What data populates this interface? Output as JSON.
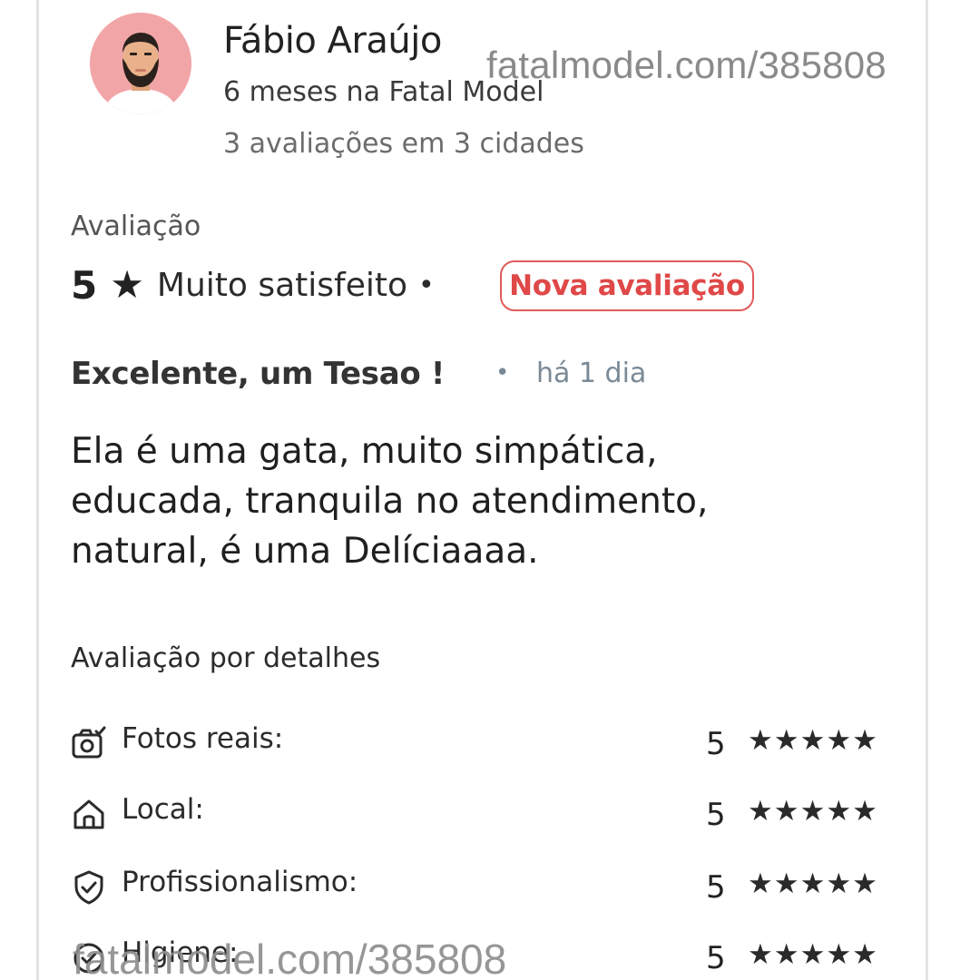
{
  "user": {
    "name": "Fábio Araújo",
    "tenure": "6 meses na Fatal Model",
    "stats": "3 avaliações em 3 cidades"
  },
  "watermark": {
    "top": "fatalmodel.com/385808",
    "bottom": "fatalmodel.com/385808"
  },
  "rating": {
    "section_label": "Avaliação",
    "score": "5",
    "star_glyph": "★",
    "description": "Muito satisfeito",
    "separator": "•",
    "badge": "Nova avaliação"
  },
  "review": {
    "title": "Excelente, um Tesao !",
    "separator": "•",
    "time": "há 1 dia",
    "body_lines": [
      "Ela é uma gata, muito simpática,",
      "educada, tranquila no atendimento,",
      "natural, é uma Delíciaaaa."
    ]
  },
  "details": {
    "section_label": "Avaliação por detalhes",
    "items": [
      {
        "label": "Fotos reais:",
        "score": "5",
        "stars": "★★★★★",
        "icon": "camera-check-icon"
      },
      {
        "label": "Local:",
        "score": "5",
        "stars": "★★★★★",
        "icon": "home-icon"
      },
      {
        "label": "Profissionalismo:",
        "score": "5",
        "stars": "★★★★★",
        "icon": "shield-check-icon"
      },
      {
        "label": "Higiene:",
        "score": "5",
        "stars": "★★★★★",
        "icon": "check-circle-icon"
      }
    ]
  },
  "colors": {
    "badge": "#e04848",
    "avatar_bg": "#f2a5a7",
    "muted": "#7a8a96"
  }
}
